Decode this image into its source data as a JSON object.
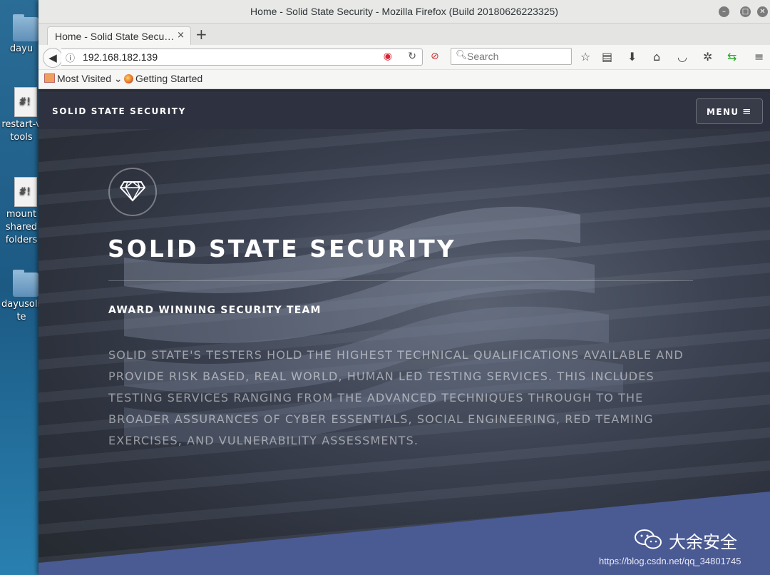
{
  "desktop": {
    "icons": [
      {
        "label": "dayu",
        "type": "folder"
      },
      {
        "label": "restart-v tools",
        "line1": "restart-v",
        "line2": "tools",
        "type": "script"
      },
      {
        "label": "mount shared folders",
        "line1": "mount",
        "line2": "shared",
        "line3": "folders",
        "type": "script"
      },
      {
        "label": "dayusolicite",
        "line1": "dayusolic",
        "line2": "te",
        "type": "folder"
      }
    ]
  },
  "window": {
    "title": "Home - Solid State Security - Mozilla Firefox (Build 20180626223325)",
    "controls": {
      "minimize": "minimize",
      "maximize": "maximize",
      "close": "close"
    }
  },
  "tabs": [
    {
      "label": "Home - Solid State Secu…",
      "close": "×"
    }
  ],
  "newtab_label": "+",
  "navbar": {
    "url": "192.168.182.139",
    "search_placeholder": "Search"
  },
  "bookmarks": [
    {
      "label": "Most Visited"
    },
    {
      "label": "Getting Started"
    }
  ],
  "site": {
    "brand": "SOLID STATE SECURITY",
    "menu_label": "MENU",
    "hero_title": "SOLID STATE SECURITY",
    "hero_subtitle": "AWARD WINNING SECURITY TEAM",
    "hero_body": "SOLID STATE'S TESTERS HOLD THE HIGHEST TECHNICAL QUALIFICATIONS AVAILABLE AND PROVIDE RISK BASED, REAL WORLD, HUMAN LED TESTING SERVICES. THIS INCLUDES TESTING SERVICES RANGING FROM THE ADVANCED TECHNIQUES THROUGH TO THE BROADER ASSURANCES OF CYBER ESSENTIALS, SOCIAL ENGINEERING, RED TEAMING EXERCISES, AND VULNERABILITY ASSESSMENTS."
  },
  "watermark": {
    "text": "大余安全",
    "url": "https://blog.csdn.net/qq_34801745"
  },
  "colors": {
    "wave": "#4a5a93",
    "page_header": "#2e3240",
    "desktop": "#1f5f8a"
  }
}
